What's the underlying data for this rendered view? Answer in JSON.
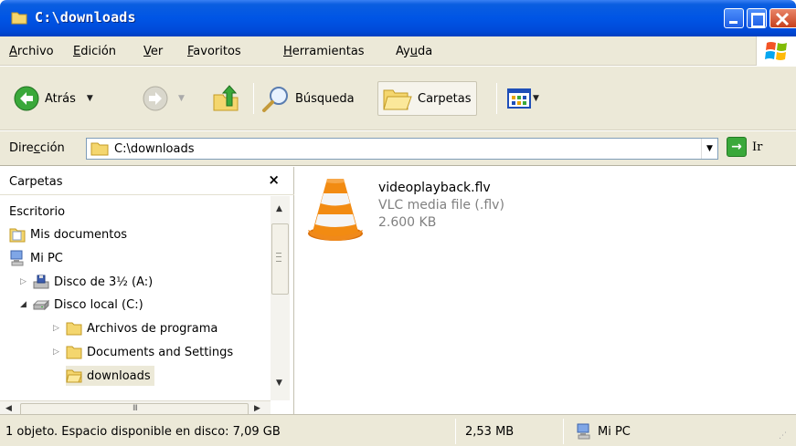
{
  "window": {
    "title": "C:\\downloads"
  },
  "menu": {
    "items": [
      {
        "pre": "",
        "ul": "A",
        "post": "rchivo"
      },
      {
        "pre": "",
        "ul": "E",
        "post": "dición"
      },
      {
        "pre": "",
        "ul": "V",
        "post": "er"
      },
      {
        "pre": "",
        "ul": "F",
        "post": "avoritos"
      },
      {
        "pre": "",
        "ul": "H",
        "post": "erramientas"
      },
      {
        "pre": "Ay",
        "ul": "u",
        "post": "da"
      }
    ]
  },
  "toolbar": {
    "back_label": "Atrás",
    "search_label": "Búsqueda",
    "folders_label": "Carpetas"
  },
  "address": {
    "label_pre": "Dire",
    "label_ul": "c",
    "label_post": "ción",
    "value": "C:\\downloads",
    "go_label": "Ir"
  },
  "folders_pane": {
    "title": "Carpetas",
    "close_glyph": "×",
    "items": [
      {
        "label": "Escritorio",
        "icon": "desktop-icon"
      },
      {
        "label": "Mis documentos",
        "icon": "my-documents-icon"
      },
      {
        "label": "Mi PC",
        "icon": "my-computer-icon"
      },
      {
        "label": "Disco de 3½ (A:)",
        "icon": "floppy-drive-icon",
        "expander": "▷"
      },
      {
        "label": "Disco local (C:)",
        "icon": "hard-drive-icon",
        "expander": "◢"
      },
      {
        "label": "Archivos de programa",
        "icon": "folder-icon",
        "expander": "▷"
      },
      {
        "label": "Documents and Settings",
        "icon": "folder-icon",
        "expander": "▷"
      },
      {
        "label": "downloads",
        "icon": "folder-open-icon",
        "selected": true
      }
    ],
    "hscroll_grip": "III"
  },
  "files": [
    {
      "name": "videoplayback.flv",
      "type": "VLC media file (.flv)",
      "size": "2.600 KB",
      "icon": "vlc-cone-icon"
    }
  ],
  "statusbar": {
    "objects": "1 objeto. Espacio disponible en disco: 7,09 GB",
    "size": "2,53 MB",
    "zone": "Mi PC"
  },
  "colors": {
    "titlebar": "#0055e5",
    "chrome": "#ece9d8",
    "close_button": "#c7401d"
  }
}
